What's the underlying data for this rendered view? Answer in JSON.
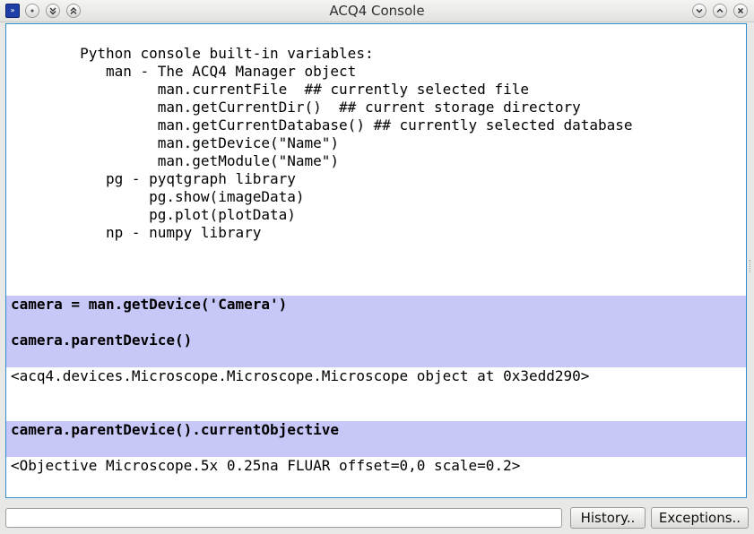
{
  "window": {
    "title": "ACQ4 Console",
    "app_icon_glyph": "»"
  },
  "console": {
    "lines": [
      "        Python console built-in variables:",
      "           man - The ACQ4 Manager object",
      "                 man.currentFile  ## currently selected file",
      "                 man.getCurrentDir()  ## current storage directory",
      "                 man.getCurrentDatabase() ## currently selected database",
      "                 man.getDevice(\"Name\")",
      "                 man.getModule(\"Name\")",
      "           pg - pyqtgraph library",
      "                pg.show(imageData)",
      "                pg.plot(plotData)",
      "           np - numpy library"
    ],
    "cmd1": "camera = man.getDevice('Camera')",
    "cmd2": "camera.parentDevice()",
    "out2": "<acq4.devices.Microscope.Microscope.Microscope object at 0x3edd290>",
    "cmd3": "camera.parentDevice().currentObjective",
    "out3": "<Objective Microscope.5x 0.25na FLUAR offset=0,0 scale=0.2>"
  },
  "input": {
    "value": ""
  },
  "buttons": {
    "history": "History..",
    "exceptions": "Exceptions.."
  },
  "colors": {
    "command_highlight": "#c8c8f8",
    "focus_border": "#2d8fcf"
  }
}
